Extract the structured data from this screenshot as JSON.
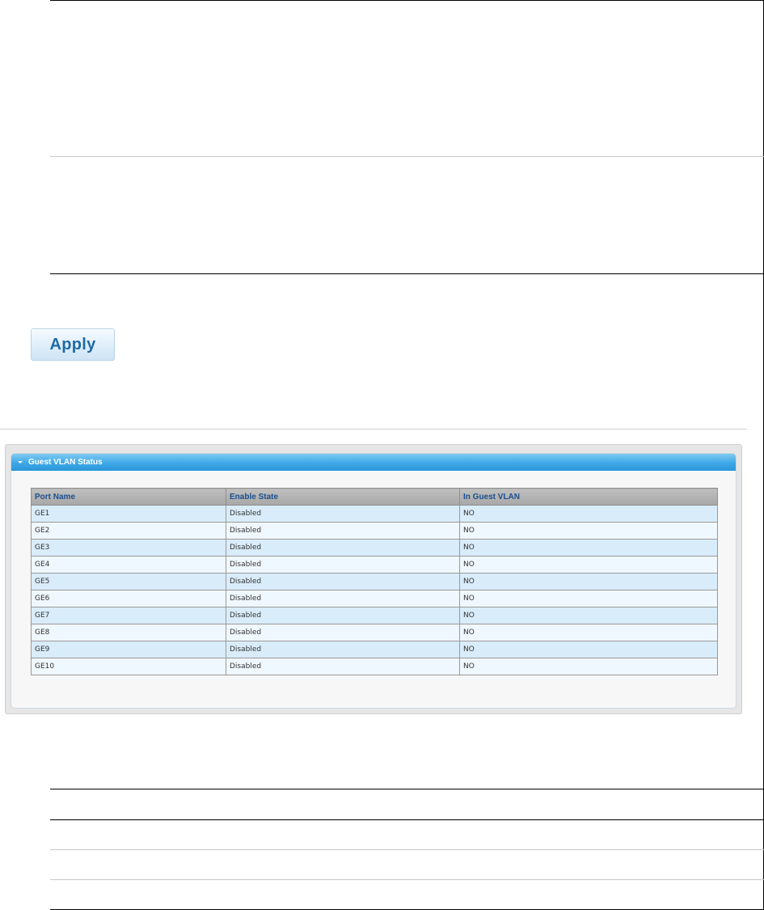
{
  "apply_button": {
    "label": "Apply"
  },
  "panel": {
    "title": "Guest VLAN Status",
    "columns": [
      "Port Name",
      "Enable State",
      "In Guest VLAN"
    ],
    "rows": [
      [
        "GE1",
        "Disabled",
        "NO"
      ],
      [
        "GE2",
        "Disabled",
        "NO"
      ],
      [
        "GE3",
        "Disabled",
        "NO"
      ],
      [
        "GE4",
        "Disabled",
        "NO"
      ],
      [
        "GE5",
        "Disabled",
        "NO"
      ],
      [
        "GE6",
        "Disabled",
        "NO"
      ],
      [
        "GE7",
        "Disabled",
        "NO"
      ],
      [
        "GE8",
        "Disabled",
        "NO"
      ],
      [
        "GE9",
        "Disabled",
        "NO"
      ],
      [
        "GE10",
        "Disabled",
        "NO"
      ]
    ]
  },
  "icons": {
    "collapse": "chevron-down-icon"
  },
  "colors": {
    "header_blue": "#3ea8e6",
    "row_odd": "#d9ecfa",
    "row_even": "#f0f8ff",
    "header_text": "#1b4f8f",
    "button_text": "#1f6aa5"
  }
}
